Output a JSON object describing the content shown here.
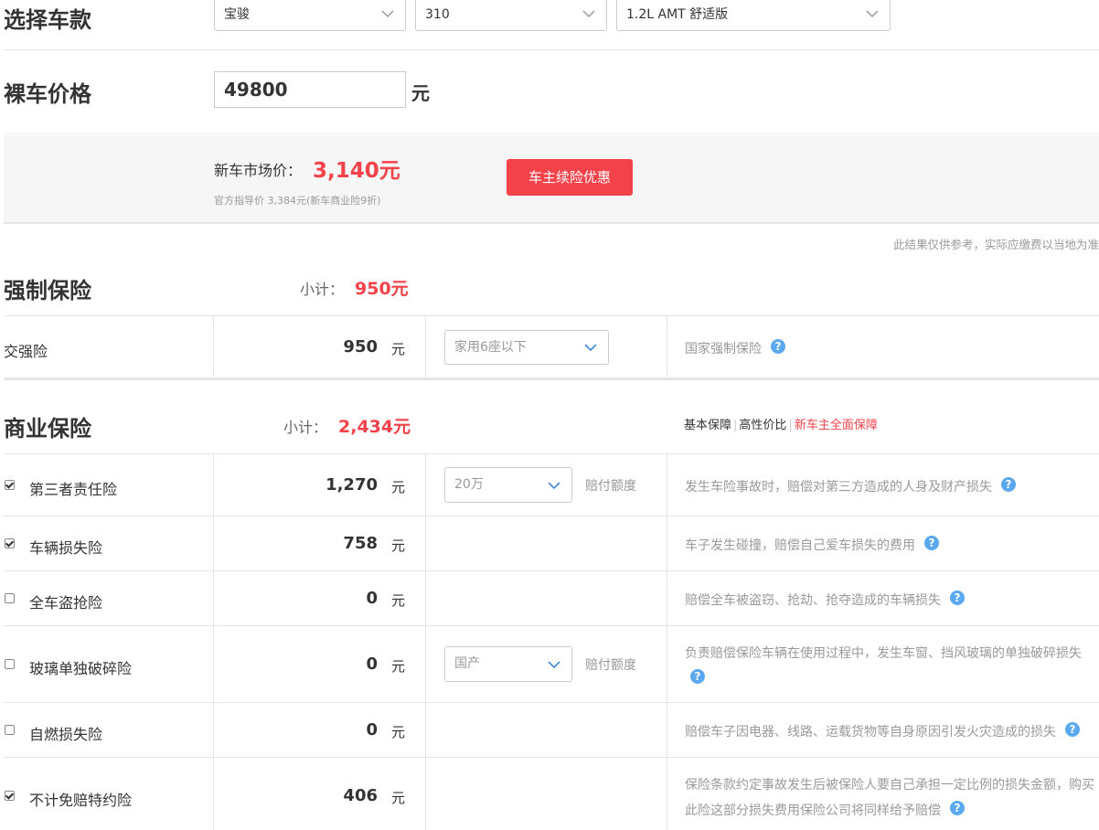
{
  "car_select": {
    "title": "选择车款",
    "brand": "宝骏",
    "model": "310",
    "trim": "1.2L AMT 舒适版"
  },
  "price": {
    "title": "裸车价格",
    "value": "49800",
    "unit": "元"
  },
  "market": {
    "label": "新车市场价：",
    "value": "3,140元",
    "sub": "官方指导价 3,384元(新车商业险9折)",
    "button": "车主续险优惠"
  },
  "disclaimer": "此结果仅供参考，实际应缴费以当地为准",
  "compulsory": {
    "title": "强制保险",
    "subtotal_label": "小计：",
    "subtotal_value": "950元",
    "row": {
      "name": "交强险",
      "amount": "950",
      "unit": "元",
      "select": "家用6座以下",
      "desc": "国家强制保险"
    }
  },
  "commercial": {
    "title": "商业保险",
    "subtotal_label": "小计：",
    "subtotal_value": "2,434元",
    "links": [
      "基本保障",
      "高性价比",
      "新车主全面保障"
    ],
    "rows": [
      {
        "name": "第三者责任险",
        "checked": true,
        "amount": "1,270",
        "unit": "元",
        "select": "20万",
        "select_label": "赔付额度",
        "desc": "发生车险事故时，赔偿对第三方造成的人身及财产损失"
      },
      {
        "name": "车辆损失险",
        "checked": true,
        "amount": "758",
        "unit": "元",
        "desc": "车子发生碰撞，赔偿自己爱车损失的费用"
      },
      {
        "name": "全车盗抢险",
        "checked": false,
        "amount": "0",
        "unit": "元",
        "desc": "赔偿全车被盗窃、抢劫、抢夺造成的车辆损失"
      },
      {
        "name": "玻璃单独破碎险",
        "checked": false,
        "amount": "0",
        "unit": "元",
        "select": "国产",
        "select_label": "赔付额度",
        "desc": "负责赔偿保险车辆在使用过程中，发生车窗、挡风玻璃的单独破碎损失"
      },
      {
        "name": "自燃损失险",
        "checked": false,
        "amount": "0",
        "unit": "元",
        "desc": "赔偿车子因电器、线路、运载货物等自身原因引发火灾造成的损失"
      },
      {
        "name": "不计免赔特约险",
        "checked": true,
        "amount": "406",
        "unit": "元",
        "desc": "保险条款约定事故发生后被保险人要自己承担一定比例的损失金额，购买",
        "desc2": "此险这部分损失费用保险公司将同样给予赔偿"
      }
    ]
  },
  "colors": {
    "accent": "#f3424a",
    "help": "#5aa8f0"
  },
  "icons": {
    "chevron": "chevron-down-icon",
    "help": "help-icon",
    "checkbox": "checkbox-icon"
  }
}
